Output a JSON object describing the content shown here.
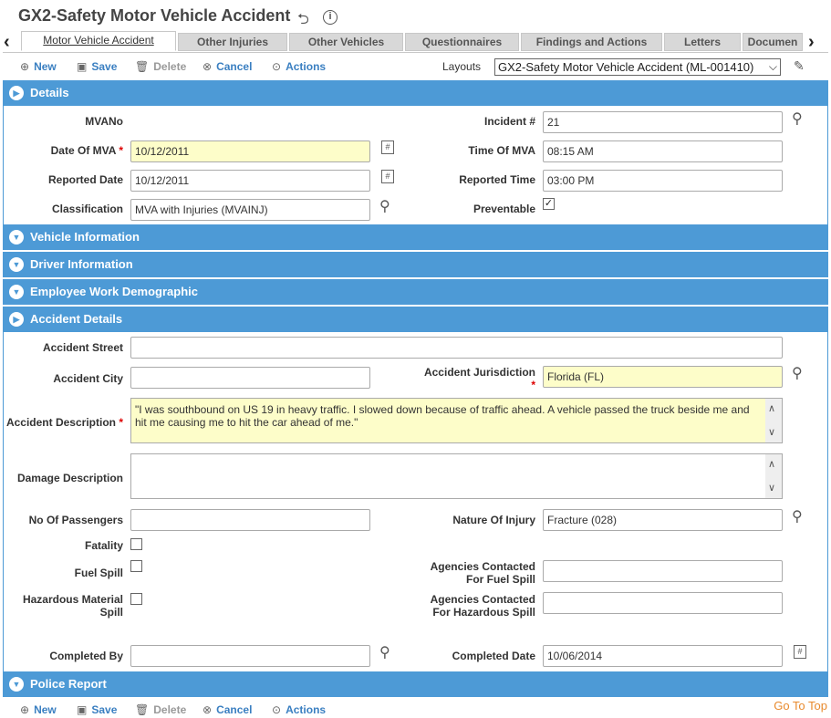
{
  "title": "GX2-Safety Motor Vehicle Accident",
  "tabs": [
    "Motor Vehicle Accident",
    "Other Injuries",
    "Other Vehicles",
    "Questionnaires",
    "Findings and Actions",
    "Letters",
    "Documen"
  ],
  "toolbar": {
    "new": "New",
    "save": "Save",
    "delete": "Delete",
    "cancel": "Cancel",
    "actions": "Actions"
  },
  "layouts": {
    "label": "Layouts",
    "selected": "GX2-Safety Motor Vehicle Accident (ML-001410)"
  },
  "sections": {
    "details": "Details",
    "vehicle": "Vehicle Information",
    "driver": "Driver Information",
    "employee": "Employee Work Demographic",
    "accident": "Accident Details",
    "police": "Police Report"
  },
  "details": {
    "mvano_label": "MVANo",
    "incident_label": "Incident #",
    "incident_value": "21",
    "date_mva_label": "Date Of MVA",
    "date_mva_value": "10/12/2011",
    "time_mva_label": "Time Of MVA",
    "time_mva_value": "08:15 AM",
    "reported_date_label": "Reported Date",
    "reported_date_value": "10/12/2011",
    "reported_time_label": "Reported Time",
    "reported_time_value": "03:00 PM",
    "classification_label": "Classification",
    "classification_value": "MVA with Injuries (MVAINJ)",
    "preventable_label": "Preventable",
    "preventable_checked": true
  },
  "accident": {
    "street_label": "Accident Street",
    "street_value": "",
    "city_label": "Accident City",
    "city_value": "",
    "jurisdiction_label": "Accident Jurisdiction",
    "jurisdiction_value": "Florida (FL)",
    "description_label": "Accident Description",
    "description_value": "\"I was southbound on US 19 in heavy traffic. I slowed down because of traffic ahead. A vehicle passed the truck beside me and hit me causing me to hit the car ahead of me.\"",
    "damage_label": "Damage Description",
    "damage_value": "",
    "passengers_label": "No Of Passengers",
    "passengers_value": "",
    "injury_label": "Nature Of Injury",
    "injury_value": "Fracture (028)",
    "fatality_label": "Fatality",
    "fuel_spill_label": "Fuel Spill",
    "agencies_fuel_label_1": "Agencies Contacted",
    "agencies_fuel_label_2": "For Fuel Spill",
    "hazmat_label_1": "Hazardous Material",
    "hazmat_label_2": "Spill",
    "agencies_haz_label_1": "Agencies Contacted",
    "agencies_haz_label_2": "For Hazardous Spill",
    "completed_by_label": "Completed By",
    "completed_by_value": "",
    "completed_date_label": "Completed Date",
    "completed_date_value": "10/06/2014"
  },
  "goto_top": "Go To Top",
  "colors": {
    "section_bg": "#4d9ad6",
    "link": "#3a7fc1",
    "required": "#dd0000",
    "highlight": "#fdfdc9"
  }
}
